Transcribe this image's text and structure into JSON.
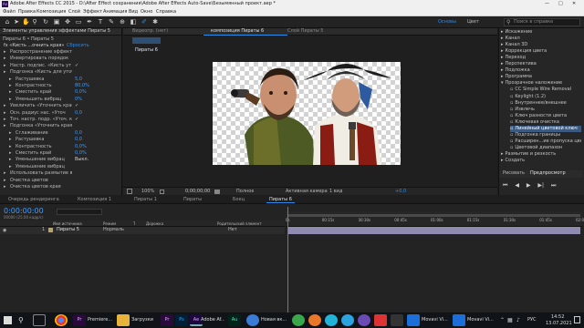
{
  "window": {
    "title": "Adobe After Effects CC 2015 - D:\\After Effect сохранения\\Adobe After Effects Auto-Save\\Безымянный проект.aep *",
    "controls": [
      "—",
      "□",
      "✕"
    ]
  },
  "menu": [
    "Файл",
    "Правка",
    "Композиция",
    "Слой",
    "Эффект",
    "Анимация",
    "Вид",
    "Окно",
    "Справка"
  ],
  "toolbar": {
    "workspace_tabs": [
      "Основы",
      "Цвет"
    ],
    "search_placeholder": "Поиск в справке"
  },
  "effect_controls": {
    "tab_label": "Элементы управления эффектами Пираты 5",
    "breadcrumb": "Пираты 6 • Пираты 5",
    "effect_name": "fx «Кисть ...очнить края»",
    "reset_label": "Сбросить",
    "rows": [
      {
        "label": "Распространение эффекта «Кисть",
        "value": ""
      },
      {
        "label": "Инвертировать порядок",
        "value": ""
      },
      {
        "label": "Настр. подпис. «Кисть ут",
        "value": "✓"
      },
      {
        "label": "Подгонка «Кисть для уточнения»",
        "value": ""
      },
      {
        "label": "Растушевка",
        "value": "5,0"
      },
      {
        "label": "Контрастность",
        "value": "80,0%"
      },
      {
        "label": "Сместить край",
        "value": "0,0%"
      },
      {
        "label": "Уменьшить вибрац",
        "value": "0%"
      },
      {
        "label": "Увеличить «Уточнить край»",
        "value": "✓"
      },
      {
        "label": "Осн. радиус нас. «Уточ",
        "value": "0,0"
      },
      {
        "label": "Точ. настр. подр. «Уточ. к",
        "value": "✓"
      },
      {
        "label": "Подгонка «Уточнить края»",
        "value": ""
      },
      {
        "label": "Сглаживание",
        "value": "0,0"
      },
      {
        "label": "Растушевка",
        "value": "0,0"
      },
      {
        "label": "Контрастность",
        "value": "0,0%"
      },
      {
        "label": "Сместить край",
        "value": "0,0%"
      },
      {
        "label": "Уменьшение вибрац",
        "value": "Выкл."
      },
      {
        "label": "Уменьшение вибрац",
        "value": ""
      },
      {
        "label": "Использовать размытие в",
        "value": ""
      },
      {
        "label": "Очистка цветов",
        "value": ""
      },
      {
        "label": "Очистка цветов края",
        "value": ""
      }
    ]
  },
  "composition": {
    "tabs": [
      "Видеопр. (нет)",
      "композиция Пираты 6",
      "Слой Пираты 5"
    ],
    "active_tab": "композиция Пираты 6",
    "sub_tab": "Пираты 6",
    "bottom_bar": [
      "100%",
      "Полное",
      "Активная камера",
      "1 вид",
      "+0,0"
    ],
    "timecode": "0;00;00;00"
  },
  "effects_panel": {
    "items": [
      {
        "label": "Искажение",
        "expanded": false
      },
      {
        "label": "Канал",
        "expanded": false
      },
      {
        "label": "Канал 3D",
        "expanded": false
      },
      {
        "label": "Коррекция цвета",
        "expanded": false
      },
      {
        "label": "Переход",
        "expanded": false
      },
      {
        "label": "Перспектива",
        "expanded": false
      },
      {
        "label": "Подложка",
        "expanded": false
      },
      {
        "label": "Программа",
        "expanded": false
      },
      {
        "label": "Прозрачное наложение",
        "expanded": true
      },
      {
        "label": "CC Simple Wire Removal",
        "expanded": false
      },
      {
        "label": "Keylight (1.2)",
        "expanded": false
      },
      {
        "label": "Внутреннее/внешнее",
        "expanded": false
      },
      {
        "label": "Извлечь",
        "expanded": false
      },
      {
        "label": "Ключ разности цвета",
        "expanded": false
      },
      {
        "label": "Ключевая очистка",
        "expanded": false
      },
      {
        "label": "Линейный цветовой ключ",
        "expanded": false,
        "selected": true
      },
      {
        "label": "Подгонка границы",
        "expanded": false
      },
      {
        "label": "Расширен...ие пропуска цвета",
        "expanded": false
      },
      {
        "label": "Цветовой диапазон",
        "expanded": false
      },
      {
        "label": "Размытие и резкость",
        "expanded": false
      },
      {
        "label": "Создать",
        "expanded": false
      }
    ],
    "bottom_tabs": [
      "Рисовать",
      "Предпросмотр"
    ]
  },
  "timeline": {
    "tabs": [
      "Очередь рендеринга",
      "Композиция 1",
      "Пираты 1",
      "Пираты",
      "Боец",
      "Пираты 6"
    ],
    "active_tab": "Пираты 6",
    "timecode": "0:00:00:00",
    "fps": "00000 (25.00 кадр/с)",
    "col_headers": [
      "Имя источника",
      "Режим",
      "T",
      "Дорожка",
      "Родительский элемент"
    ],
    "layer": {
      "number": "1",
      "name": "Пираты 5",
      "mode": "Нормаль",
      "parent": "Нет"
    },
    "ruler": [
      "0s",
      "00:15s",
      "00:30s",
      "00:45s",
      "01:00s",
      "01:15s",
      "01:30s",
      "01:45s",
      "02:0"
    ]
  },
  "taskbar": {
    "apps": [
      "Premiere...",
      "Загрузки",
      "Adobe Af...",
      "Новая вк...",
      "Movavi Vi...",
      "Movavi Vi..."
    ],
    "lang": "РУС",
    "time": "14:52",
    "date": "13.07.2021"
  },
  "colors": {
    "accent_blue": "#2d8ceb",
    "selection": "#3c5a80",
    "panel": "#262626"
  }
}
